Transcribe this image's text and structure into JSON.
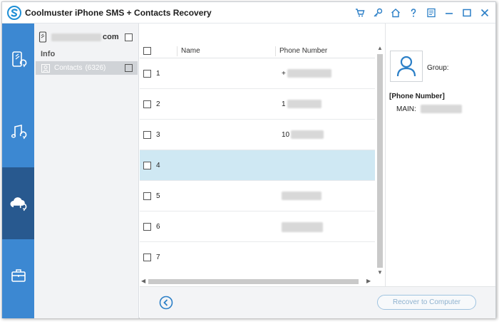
{
  "app": {
    "title": "Coolmuster iPhone SMS + Contacts Recovery"
  },
  "titlebar_icons": [
    "cart-icon",
    "key-icon",
    "home-icon",
    "help-icon",
    "feedback-icon",
    "minimize-icon",
    "maximize-icon",
    "close-icon"
  ],
  "rail": {
    "items": [
      "phone-restore-icon",
      "music-restore-icon",
      "cloud-restore-icon",
      "toolbox-icon"
    ],
    "active_index": 2
  },
  "tree": {
    "device_suffix": "com",
    "info_label": "Info",
    "contacts_label": "Contacts",
    "contacts_count": "(6326)"
  },
  "list": {
    "columns": {
      "name": "Name",
      "phone": "Phone Number"
    },
    "rows": [
      {
        "num": "1",
        "phone_prefix": "+",
        "selected": false
      },
      {
        "num": "2",
        "phone_prefix": "1",
        "selected": false
      },
      {
        "num": "3",
        "phone_prefix": "10",
        "selected": false
      },
      {
        "num": "4",
        "phone_prefix": "",
        "selected": true
      },
      {
        "num": "5",
        "phone_prefix": "",
        "selected": false
      },
      {
        "num": "6",
        "phone_prefix": "",
        "selected": false
      },
      {
        "num": "7",
        "phone_prefix": "",
        "selected": false
      }
    ]
  },
  "detail": {
    "group_label": "Group:",
    "phone_heading": "[Phone Number]",
    "main_label": "MAIN:"
  },
  "bottom": {
    "recover_label": "Recover to Computer"
  },
  "colors": {
    "rail": "#3c88d2",
    "rail_active": "#28598f",
    "selected_row": "#cfe8f3",
    "accent": "#1e8fd6"
  }
}
